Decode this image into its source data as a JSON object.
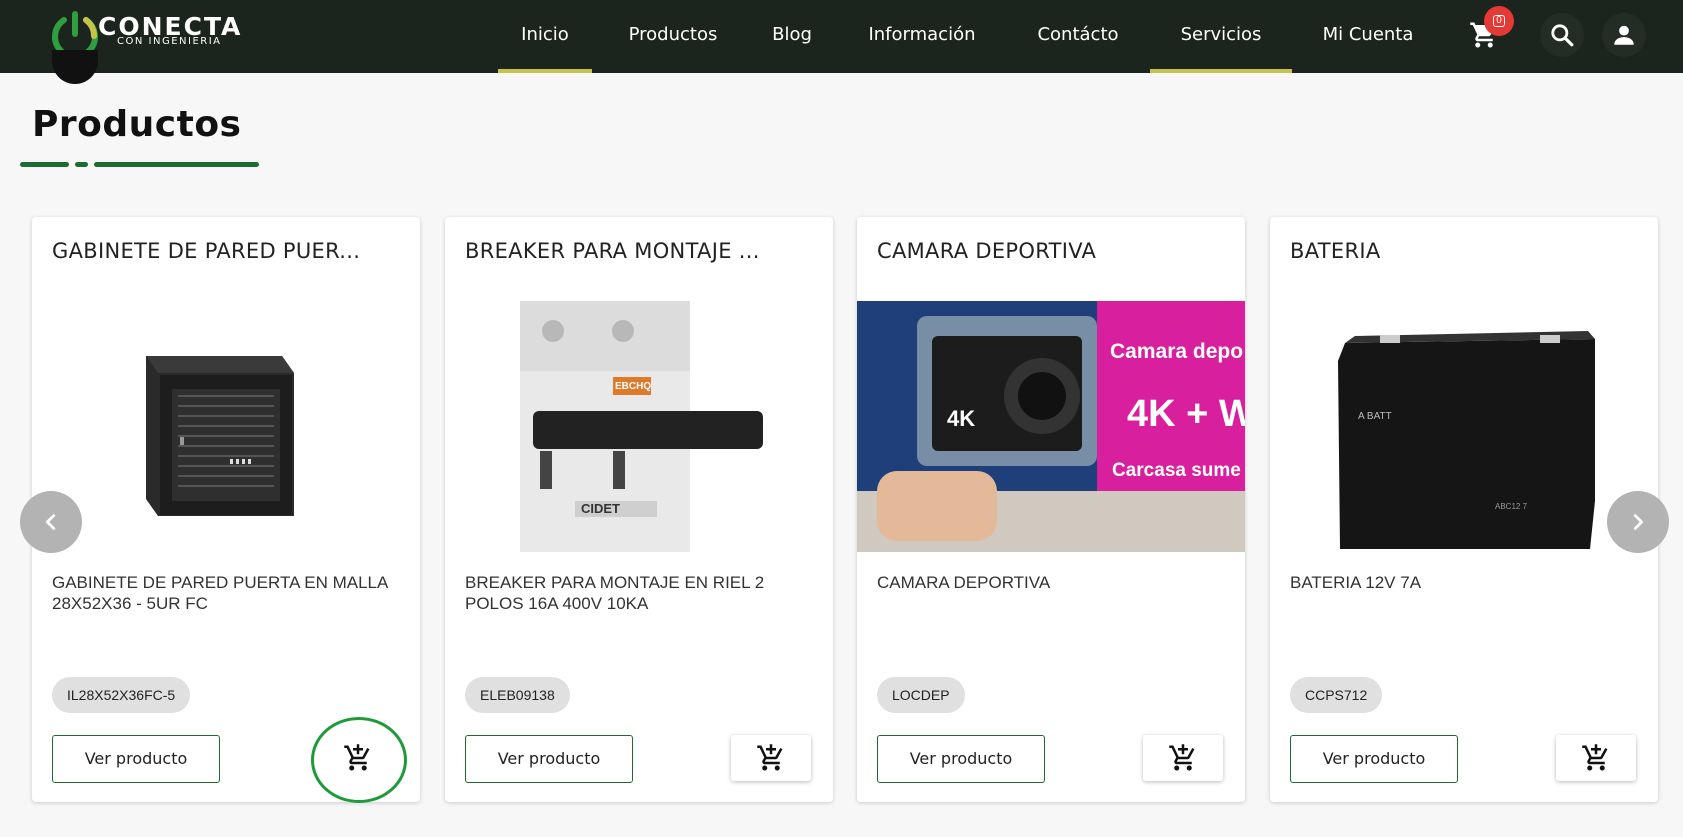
{
  "brand": {
    "name": "CONECTA",
    "tagline": "CON INGENIERIA",
    "colors": {
      "navbar": "#1b241d",
      "accent": "#1d6b33",
      "active_underline": "#c7c24a",
      "badge": "#e53935"
    }
  },
  "nav": {
    "items": [
      {
        "label": "Inicio",
        "active": true
      },
      {
        "label": "Productos",
        "active": false
      },
      {
        "label": "Blog",
        "active": false
      },
      {
        "label": "Información",
        "active": false
      },
      {
        "label": "Contácto",
        "active": false
      },
      {
        "label": "Servicios",
        "active": true
      },
      {
        "label": "Mi Cuenta",
        "active": false
      }
    ],
    "icons": {
      "cart": "shopping-cart-icon",
      "search": "search-icon",
      "account": "person-icon"
    },
    "cart_count": "0"
  },
  "section": {
    "title": "Productos"
  },
  "products": [
    {
      "title": "GABINETE DE PARED PUER...",
      "description": "GABINETE DE PARED PUERTA EN MALLA 28X52X36 - 5UR FC",
      "sku": "IL28X52X36FC-5",
      "view_label": "Ver producto"
    },
    {
      "title": "BREAKER PARA MONTAJE ...",
      "description": "BREAKER PARA MONTAJE EN RIEL 2 POLOS 16A 400V 10KA",
      "sku": "ELEB09138",
      "view_label": "Ver producto",
      "image_text": {
        "brand": "EBCHQ",
        "logo": "CIDET"
      }
    },
    {
      "title": "CAMARA DEPORTIVA",
      "description": "CAMARA DEPORTIVA",
      "sku": "LOCDEP",
      "view_label": "Ver producto",
      "image_text": {
        "line1": "Camara depo",
        "line2": "4K + W",
        "line3": "Carcasa sume",
        "badge": "4K"
      }
    },
    {
      "title": "BATERIA",
      "description": "BATERIA 12V 7A",
      "sku": "CCPS712",
      "view_label": "Ver producto",
      "image_text": {
        "label": "A BATT",
        "model": "ABC12 7"
      }
    }
  ],
  "carousel": {
    "prev_icon": "chevron-left-icon",
    "next_icon": "chevron-right-icon"
  }
}
